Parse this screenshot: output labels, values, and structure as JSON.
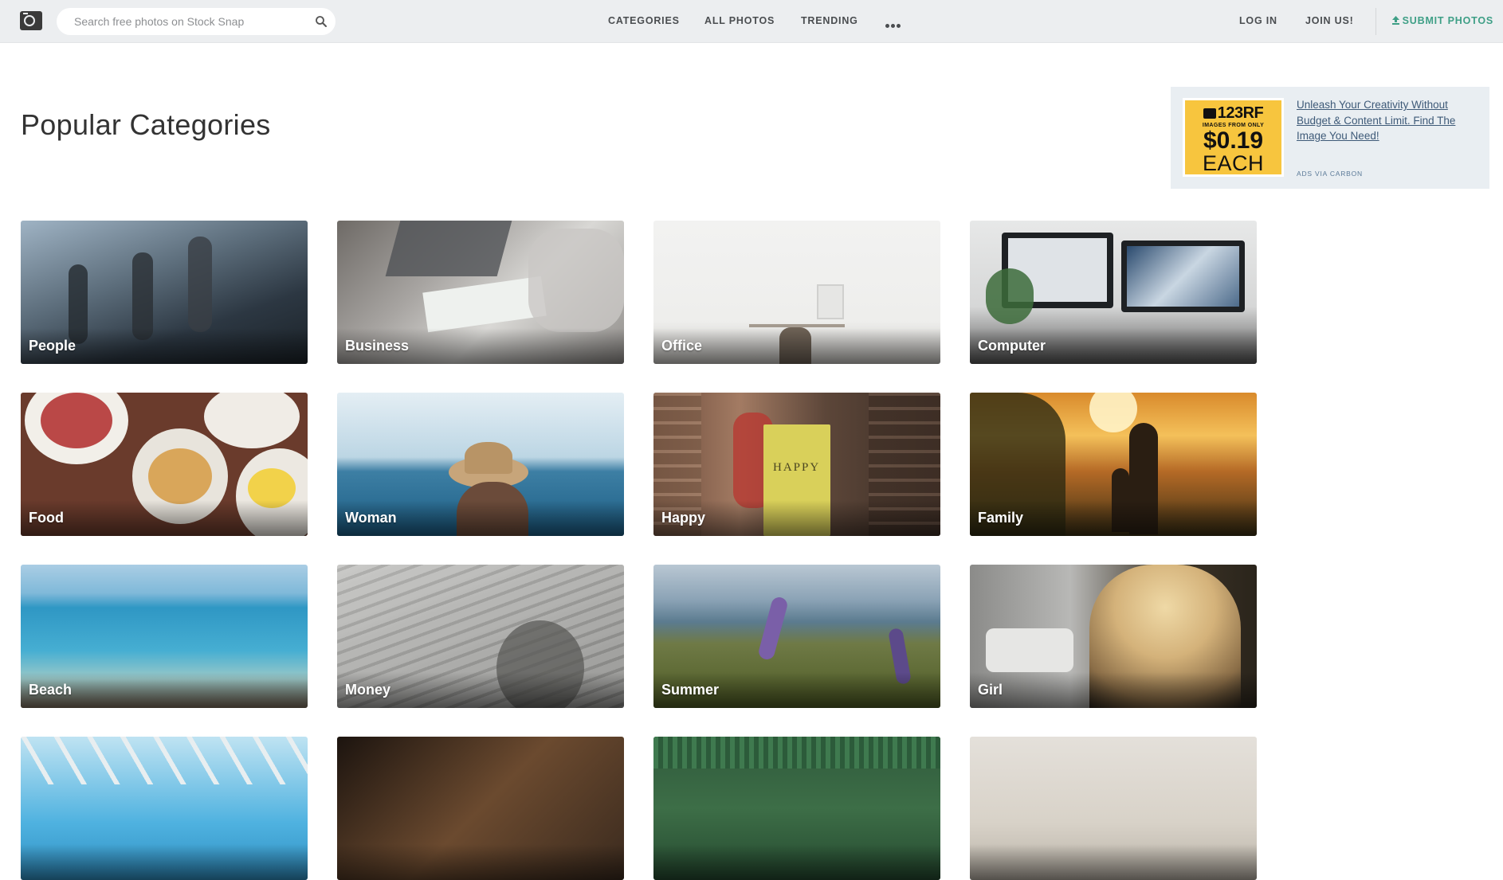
{
  "header": {
    "search_placeholder": "Search free photos on Stock Snap",
    "nav": [
      "CATEGORIES",
      "ALL PHOTOS",
      "TRENDING"
    ],
    "login": "LOG IN",
    "join": "JOIN US!",
    "submit": "SUBMIT PHOTOS",
    "icons": [
      "camera-logo-icon",
      "search-icon",
      "more-dots-icon",
      "upload-icon"
    ]
  },
  "page": {
    "title": "Popular Categories"
  },
  "ad": {
    "brand": "123RF",
    "tagline": "IMAGES FROM ONLY",
    "price": "$0.19",
    "unit": "EACH",
    "text": "Unleash Your Creativity Without Budget & Content Limit. Find The Image You Need!",
    "via": "ADS VIA CARBON"
  },
  "categories": [
    {
      "label": "People"
    },
    {
      "label": "Business"
    },
    {
      "label": "Office"
    },
    {
      "label": "Computer"
    },
    {
      "label": "Food"
    },
    {
      "label": "Woman"
    },
    {
      "label": "Happy"
    },
    {
      "label": "Family"
    },
    {
      "label": "Beach"
    },
    {
      "label": "Money"
    },
    {
      "label": "Summer"
    },
    {
      "label": "Girl"
    },
    {
      "label": ""
    },
    {
      "label": ""
    },
    {
      "label": ""
    },
    {
      "label": ""
    }
  ],
  "happy_book_text": "HAPPY",
  "colors": {
    "header_bg": "#eceef0",
    "accent": "#3e9f86",
    "ad_bg": "#e9eef2",
    "ad_yellow": "#f7c53e",
    "link": "#3e5a78"
  }
}
